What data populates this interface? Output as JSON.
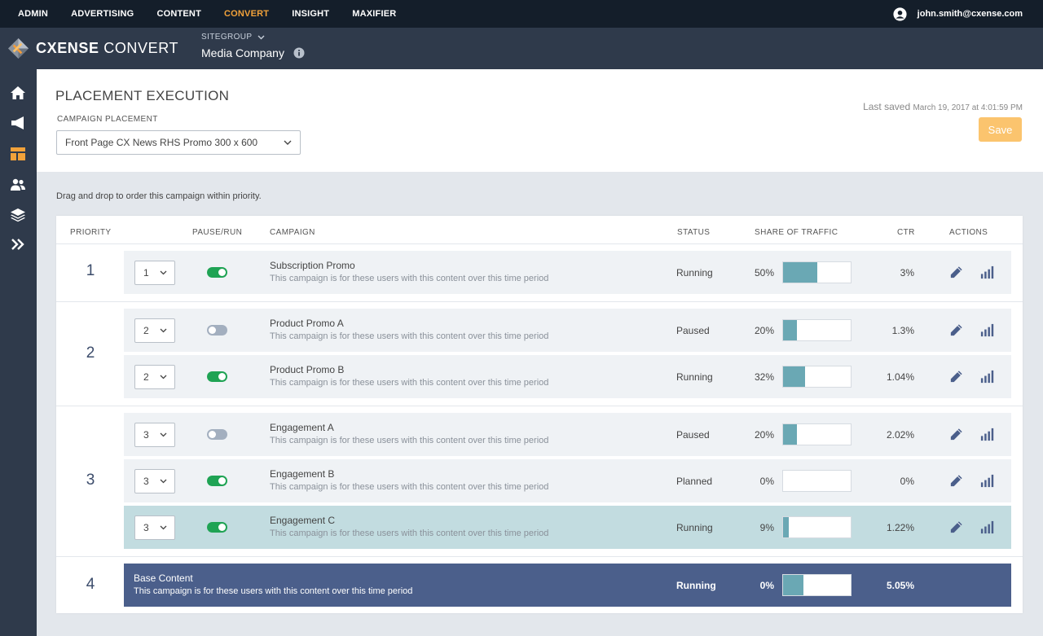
{
  "topnav": {
    "items": [
      {
        "label": "ADMIN",
        "active": false
      },
      {
        "label": "ADVERTISING",
        "active": false
      },
      {
        "label": "CONTENT",
        "active": false
      },
      {
        "label": "CONVERT",
        "active": true
      },
      {
        "label": "INSIGHT",
        "active": false
      },
      {
        "label": "MAXIFIER",
        "active": false
      }
    ],
    "user_email": "john.smith@cxense.com"
  },
  "brand": {
    "name_bold": "CXENSE",
    "name_light": " CONVERT",
    "sitegroup_label": "SITEGROUP",
    "sitegroup_value": "Media Company"
  },
  "sidebar": {
    "icons": [
      "home-icon",
      "megaphone-icon",
      "layout-icon",
      "users-icon",
      "layers-icon",
      "expand-icon"
    ]
  },
  "header": {
    "title": "PLACEMENT EXECUTION",
    "placement_label": "CAMPAIGN PLACEMENT",
    "placement_value": "Front Page CX News RHS Promo 300 x 600",
    "last_saved_label": "Last saved",
    "last_saved_time": "March 19, 2017 at 4:01:59 PM",
    "save_label": "Save"
  },
  "hint": "Drag and drop to order this campaign within priority.",
  "table": {
    "columns": {
      "priority": "PRIORITY",
      "pause_run": "PAUSE/RUN",
      "campaign": "CAMPAIGN",
      "status": "STATUS",
      "share": "SHARE OF TRAFFIC",
      "ctr": "CTR",
      "actions": "ACTIONS"
    },
    "groups": [
      {
        "priority": "1",
        "rows": [
          {
            "select": "1",
            "running": true,
            "name": "Subscription Promo",
            "desc": "This campaign is for these users with this content over this time period",
            "status": "Running",
            "share": "50%",
            "share_fraction": 0.5,
            "ctr": "3%",
            "highlight": false
          }
        ]
      },
      {
        "priority": "2",
        "rows": [
          {
            "select": "2",
            "running": false,
            "name": "Product Promo A",
            "desc": "This campaign is for these users with this content over this time period",
            "status": "Paused",
            "share": "20%",
            "share_fraction": 0.2,
            "ctr": "1.3%",
            "highlight": false
          },
          {
            "select": "2",
            "running": true,
            "name": "Product Promo B",
            "desc": "This campaign is for these users with this content over this time period",
            "status": "Running",
            "share": "32%",
            "share_fraction": 0.32,
            "ctr": "1.04%",
            "highlight": false
          }
        ]
      },
      {
        "priority": "3",
        "rows": [
          {
            "select": "3",
            "running": false,
            "name": "Engagement A",
            "desc": "This campaign is for these users with this content over this time period",
            "status": "Paused",
            "share": "20%",
            "share_fraction": 0.2,
            "ctr": "2.02%",
            "highlight": false
          },
          {
            "select": "3",
            "running": true,
            "name": "Engagement B",
            "desc": "This campaign is for these users with this content over this time period",
            "status": "Planned",
            "share": "0%",
            "share_fraction": 0.0,
            "ctr": "0%",
            "highlight": false
          },
          {
            "select": "3",
            "running": true,
            "name": "Engagement C",
            "desc": "This campaign is for these users with this content over this time period",
            "status": "Running",
            "share": "9%",
            "share_fraction": 0.09,
            "ctr": "1.22%",
            "highlight": true
          }
        ]
      }
    ],
    "base": {
      "priority": "4",
      "name": "Base Content",
      "desc": "This campaign is for these users with this content over this time period",
      "status": "Running",
      "share": "0%",
      "share_fraction": 0.3,
      "ctr": "5.05%"
    }
  },
  "colors": {
    "topnav_bg": "#141e2a",
    "brandbar_bg": "#2f3a4b",
    "accent_active": "#f2a23a",
    "save_button": "#fbc46e",
    "toggle_on": "#1fa354",
    "toggle_off": "#a3afbf",
    "share_fill": "#6aa8b4",
    "highlight_row": "#c2dce0",
    "base_row": "#4b5f8b"
  }
}
